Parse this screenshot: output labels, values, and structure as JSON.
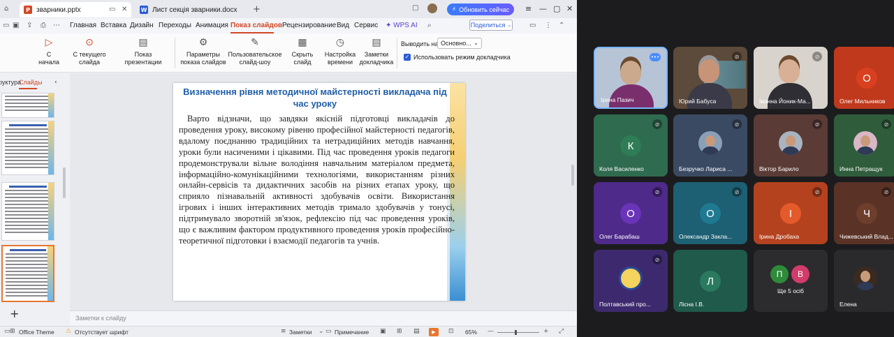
{
  "tabs": [
    {
      "name": "зварники.pptx",
      "icon": "P",
      "color": "#d24726"
    },
    {
      "name": "Лист секція зварники.docx",
      "icon": "W",
      "color": "#2b5cd6"
    }
  ],
  "update_button": "Обновить сейчас",
  "menu": [
    "Главная",
    "Вставка",
    "Дизайн",
    "Переходы",
    "Анимация",
    "Показ слайдов",
    "Рецензирование",
    "Вид",
    "Сервис",
    "WPS AI"
  ],
  "share_button": "Поделиться",
  "ribbon": {
    "from_start": "С начала",
    "from_current": "С текущего слайда",
    "show_presentation": "Показ презентации",
    "show_settings": "Параметры показа слайдов",
    "custom_show": "Пользовательское слайд-шоу",
    "hide_slide": "Скрыть слайд",
    "rehearse_timing": "Настройка времени",
    "presenter_tools": "Заметки докладчика",
    "output_to_label": "Выводить на:",
    "output_to_value": "Основно...",
    "presenter_mode_label": "Использовать режим докладчика"
  },
  "side_panel": {
    "tab_structure": "руктура",
    "tab_slides": "Слайды"
  },
  "slide": {
    "title": "Визначення рівня методичної майстерності викладача під час уроку",
    "body": "Варто відзначи, що завдяки якісній підготовці викладачів до проведення уроку, високому рівеню професійної майстерності педагогів, вдалому поєднанню традиційних та нетрадиційних методів навчання, уроки були насиченими і цікавими.  Під час проведення уроків педагоги продемонстрували вільне володіння навчальним матеріалом предмета, інформаційно-комунікаційними технологіями, використанням різних онлайн-сервісів та дидактичних засобів на різних етапах уроку, що сприяло пізнавальній активності здобувачів освіти. Використання ігрових і інших інтерактивних методів тримало здобувачів у тонусі, підтримувало зворотній зв'язок, рефлексію під час проведення уроків, що є важливим фактором продуктивного проведення уроків професійно-теоретичної підготовки і взаємодії педагогів та учнів."
  },
  "notes_placeholder": "Заметки к слайду",
  "status": {
    "theme": "Office Theme",
    "font_missing": "Отсутствует шрифт",
    "notes": "Заметки",
    "comments": "Примечание",
    "zoom": "65%"
  },
  "participants": [
    {
      "name": "Ірина Пазич",
      "type": "photo",
      "speaking": true,
      "mic": "on"
    },
    {
      "name": "Юрий Бабуса",
      "type": "photo",
      "mic": "off"
    },
    {
      "name": "Іванна Йоник-Ма...",
      "type": "photo",
      "mic": "off"
    },
    {
      "name": "Олег Мильников",
      "type": "letter",
      "letter": "О",
      "tile_color": "#c0391c",
      "avatar_color": "#d9401f"
    },
    {
      "name": "Коля Василенко",
      "type": "letter",
      "letter": "К",
      "tile_color": "#2f6b4f",
      "avatar_color": "#2e7d56",
      "mic": "off"
    },
    {
      "name": "Безручко Лариса ...",
      "type": "photo-small",
      "tile_color": "#3b4a63",
      "mic": "off"
    },
    {
      "name": "Віктор Барило",
      "type": "photo-small",
      "tile_color": "#5a3b36",
      "mic": "off"
    },
    {
      "name": "Инна Петращук",
      "type": "photo-small",
      "tile_color": "#2f5d3c",
      "mic": "off"
    },
    {
      "name": "Олег Барабаш",
      "type": "letter",
      "letter": "О",
      "tile_color": "#4e2a8a",
      "avatar_color": "#6a34b8",
      "mic": "off"
    },
    {
      "name": "Олександр Закла...",
      "type": "letter",
      "letter": "О",
      "tile_color": "#1d5f73",
      "avatar_color": "#1f7a91",
      "mic": "off"
    },
    {
      "name": "Ірина Дробаха",
      "type": "letter",
      "letter": "І",
      "tile_color": "#b4421f",
      "avatar_color": "#e55a2b",
      "mic": "off"
    },
    {
      "name": "Чижевський Влад...",
      "type": "letter",
      "letter": "Ч",
      "tile_color": "#5a3326",
      "avatar_color": "#6e3e2d",
      "mic": "off"
    },
    {
      "name": "Полтавський про...",
      "type": "emblem",
      "tile_color": "#3d2a6e",
      "mic": "off"
    },
    {
      "name": "Лісна І.В.",
      "type": "letter",
      "letter": "Л",
      "tile_color": "#1f5a4a",
      "avatar_color": "#2a7a60"
    },
    {
      "name": "Ще 5 осіб",
      "type": "group",
      "letters": [
        "П",
        "В"
      ],
      "tile_color": "#2c2c2e"
    },
    {
      "name": "Елена",
      "type": "photo-small",
      "tile_color": "#2a2a2c"
    }
  ]
}
